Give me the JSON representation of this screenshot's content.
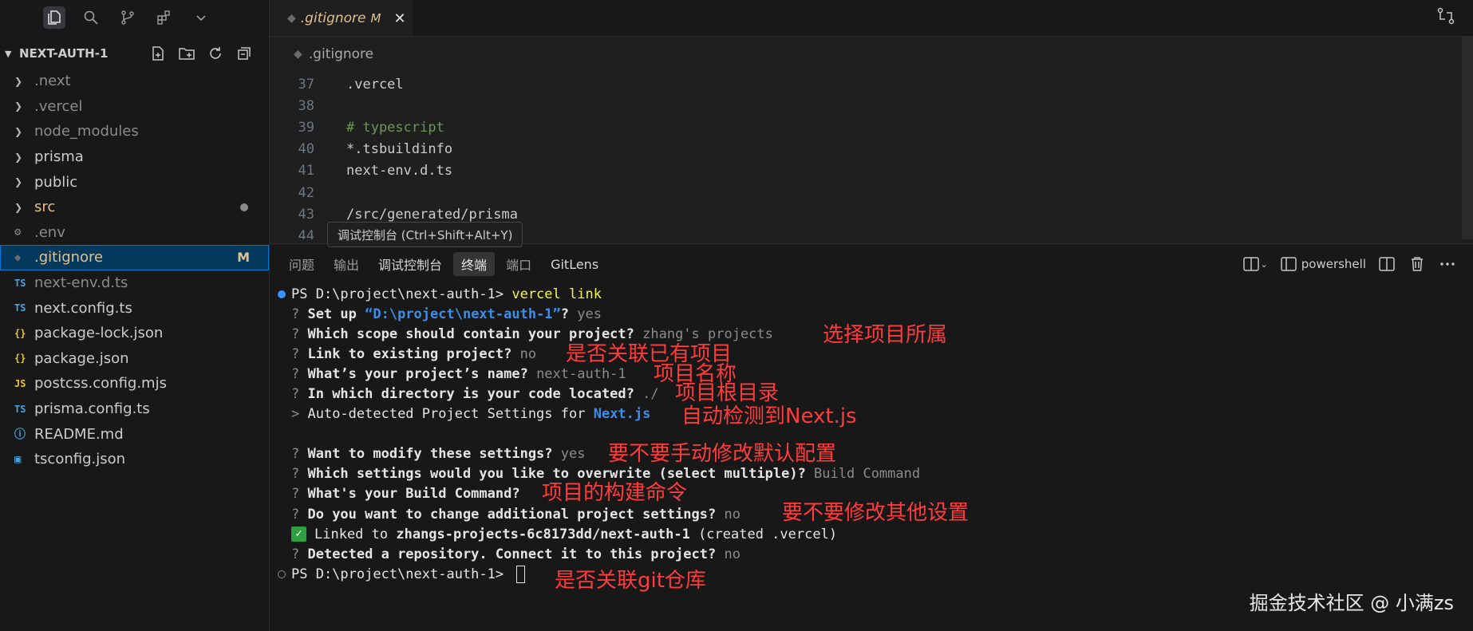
{
  "sidebar": {
    "project_name": "NEXT-AUTH-1",
    "items": [
      {
        "name": ".next",
        "kind": "folder",
        "dim": true
      },
      {
        "name": ".vercel",
        "kind": "folder",
        "dim": true
      },
      {
        "name": "node_modules",
        "kind": "folder",
        "dim": true
      },
      {
        "name": "prisma",
        "kind": "folder",
        "dim": false
      },
      {
        "name": "public",
        "kind": "folder",
        "dim": false
      },
      {
        "name": "src",
        "kind": "folder",
        "dim": false,
        "dot": true
      },
      {
        "name": ".env",
        "kind": "gear",
        "dim": true
      },
      {
        "name": ".gitignore",
        "kind": "git",
        "dim": false,
        "selected": true,
        "badge": "M"
      },
      {
        "name": "next-env.d.ts",
        "kind": "ts",
        "dim": true
      },
      {
        "name": "next.config.ts",
        "kind": "ts",
        "dim": false
      },
      {
        "name": "package-lock.json",
        "kind": "json",
        "dim": false
      },
      {
        "name": "package.json",
        "kind": "json",
        "dim": false
      },
      {
        "name": "postcss.config.mjs",
        "kind": "js",
        "dim": false
      },
      {
        "name": "prisma.config.ts",
        "kind": "ts",
        "dim": false
      },
      {
        "name": "README.md",
        "kind": "info",
        "dim": false
      },
      {
        "name": "tsconfig.json",
        "kind": "tsconfig",
        "dim": false
      }
    ]
  },
  "editor": {
    "tab": {
      "name": ".gitignore",
      "modified": "M",
      "close": "✕"
    },
    "breadcrumb": ".gitignore",
    "lines": [
      {
        "n": "37",
        "text": ".vercel",
        "comment": false
      },
      {
        "n": "38",
        "text": "",
        "comment": false
      },
      {
        "n": "39",
        "text": "# typescript",
        "comment": true
      },
      {
        "n": "40",
        "text": "*.tsbuildinfo",
        "comment": false
      },
      {
        "n": "41",
        "text": "next-env.d.ts",
        "comment": false
      },
      {
        "n": "42",
        "text": "",
        "comment": false
      },
      {
        "n": "43",
        "text": "/src/generated/prisma",
        "comment": false
      },
      {
        "n": "44",
        "text": "",
        "comment": false
      }
    ],
    "tooltip": "调试控制台 (Ctrl+Shift+Alt+Y)"
  },
  "panel": {
    "tabs": [
      "问题",
      "输出",
      "调试控制台",
      "终端",
      "端口",
      "GitLens"
    ],
    "active_tab": "终端",
    "shell": "powershell"
  },
  "terminal": {
    "prompt": "PS D:\\project\\next-auth-1> ",
    "command": "vercel link",
    "l2a": "? ",
    "l2b": "Set up ",
    "l2c": "“D:\\project\\next-auth-1”",
    "l2d": "? ",
    "l2e": "yes",
    "l3a": "? ",
    "l3b": "Which scope should contain your project? ",
    "l3c": "zhang's projects",
    "l4a": "? ",
    "l4b": "Link to existing project? ",
    "l4c": "no",
    "l5a": "? ",
    "l5b": "What’s your project’s name? ",
    "l5c": "next-auth-1",
    "l6a": "? ",
    "l6b": "In which directory is your code located? ",
    "l6c": "./",
    "l7a": "> ",
    "l7b": "Auto-detected Project Settings for ",
    "l7c": "Next.js",
    "l9a": "? ",
    "l9b": "Want to modify these settings? ",
    "l9c": "yes",
    "l10a": "? ",
    "l10b": "Which settings would you like to overwrite (select multiple)? ",
    "l10c": "Build Command",
    "l11a": "? ",
    "l11b": "What's your Build Command? ",
    "l12a": "? ",
    "l12b": "Do you want to change additional project settings? ",
    "l12c": "no",
    "l13a": "✓",
    "l13b": "Linked to ",
    "l13c": "zhangs-projects-6c8173dd/next-auth-1",
    "l13d": " (created .vercel)",
    "l14a": "? ",
    "l14b": "Detected a repository. Connect it to this project? ",
    "l14c": "no",
    "final_prompt": "PS D:\\project\\next-auth-1> "
  },
  "annotations": {
    "a1": "选择项目所属",
    "a2": "是否关联已有项目",
    "a3": "项目名称",
    "a4": "项目根目录",
    "a5": "自动检测到Next.js",
    "a6": "要不要手动修改默认配置",
    "a7": "项目的构建命令",
    "a8": "要不要修改其他设置",
    "a9": "是否关联git仓库"
  },
  "watermark": "掘金技术社区 @ 小满zs",
  "colors": {
    "accent": "#0078d4",
    "annotation": "#ff3b3b",
    "modified": "#e2c08d"
  }
}
